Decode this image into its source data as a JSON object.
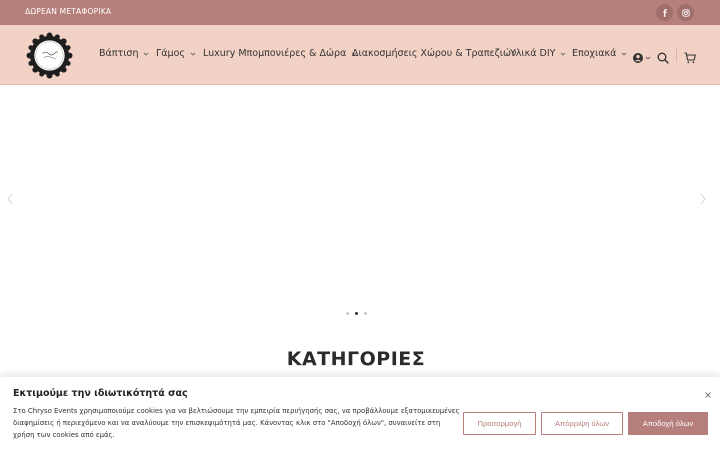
{
  "topbar": {
    "promo_text": "ΔΩΡΕΑΝ ΜΕΤΑΦΟΡΙΚΑ",
    "social": [
      "facebook-icon",
      "instagram-icon"
    ]
  },
  "header": {
    "logo_text": "Chryso Events",
    "nav": [
      {
        "label": "Βάπτιση",
        "has_dropdown": true
      },
      {
        "label": "Γάμος",
        "has_dropdown": true
      },
      {
        "label": "Luxury Μπομπονιέρες & Δώρα",
        "has_dropdown": true
      },
      {
        "label": "Διακοσμήσεις Χώρου & Τραπεζιών",
        "has_dropdown": false
      },
      {
        "label": "Υλικά DIY",
        "has_dropdown": true
      },
      {
        "label": "Εποχιακά",
        "has_dropdown": true
      }
    ],
    "icons": [
      "account-icon",
      "search-icon",
      "cart-icon"
    ]
  },
  "slider": {
    "dots": 3,
    "active_dot": 2
  },
  "categories": {
    "title": "ΚΑΤΗΓΟΡΙΕΣ"
  },
  "cookie": {
    "title": "Εκτιμούμε την ιδιωτικότητά σας",
    "text": "Στο Chryso Events χρησιμοποιούμε cookies για να βελτιώσουμε την εμπειρία περιήγησής σας, να προβάλλουμε εξατομικευμένες διαφημίσεις ή περιεχόμενο και να αναλύουμε την επισκεψιμότητά μας. Κάνοντας κλικ στο \"Αποδοχή όλων\", συναινείτε στη χρήση των cookies από εμάς.",
    "customize_label": "Προσαρμογή",
    "reject_label": "Απόρριψη όλων",
    "accept_label": "Αποδοχή όλων"
  },
  "colors": {
    "accent": "#b77f7c",
    "header_bg": "#f3d2c6"
  }
}
